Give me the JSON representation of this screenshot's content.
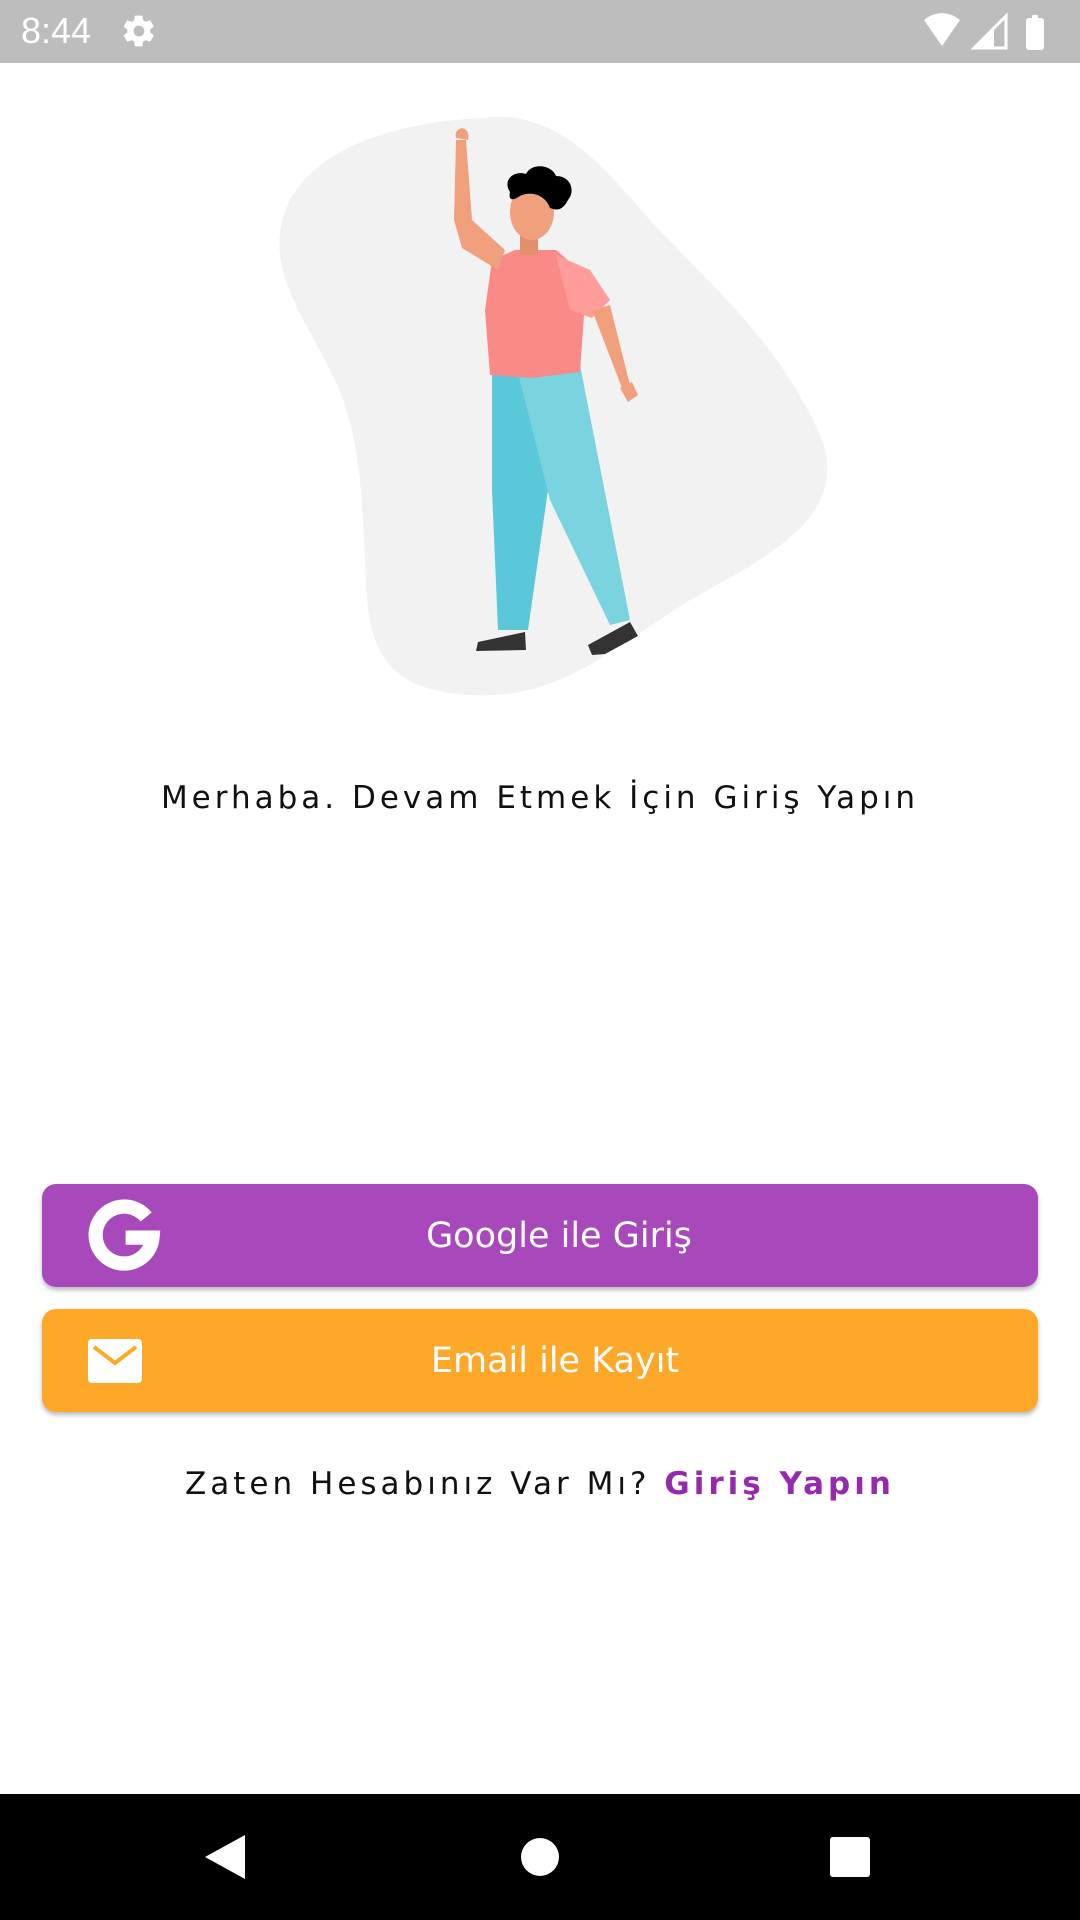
{
  "status_bar": {
    "time": "8:44",
    "icons": [
      "settings-icon",
      "wifi-icon",
      "signal-icon",
      "battery-icon"
    ]
  },
  "main": {
    "welcome_text": "Merhaba. Devam Etmek İçin Giriş Yapın",
    "google_button_label": "Google ile Giriş",
    "email_button_label": "Email ile Kayıt",
    "login_prompt": "Zaten Hesabınız Var Mı?",
    "login_link": "Giriş Yapın"
  },
  "colors": {
    "google_button": "#a849bb",
    "email_button": "#fea829",
    "login_link": "#9629ad",
    "status_bar": "#bdbdbd",
    "nav_bar": "#000000"
  },
  "nav_bar": {
    "icons": [
      "back-icon",
      "home-icon",
      "recents-icon"
    ]
  }
}
